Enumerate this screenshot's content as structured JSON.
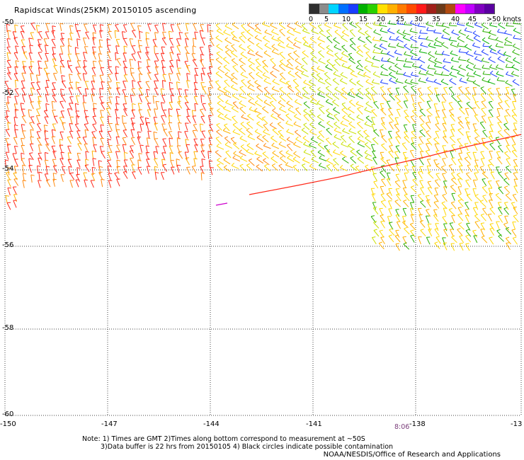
{
  "title": "Rapidscat Winds(25KM)  20150105  ascending",
  "legend": {
    "labels": [
      "0",
      "5",
      "10",
      "15",
      "20",
      "25",
      "30",
      "35",
      "40",
      "45",
      ">50 knots"
    ],
    "colors": [
      "#2f2f2f",
      "#8c8c8c",
      "#00d4ff",
      "#0070ff",
      "#1a3dff",
      "#00b000",
      "#2ad000",
      "#ffe000",
      "#ffb000",
      "#ff7a00",
      "#ff4a00",
      "#ff1a1a",
      "#a0201a",
      "#6a3a1a",
      "#b04a10",
      "#ff00ff",
      "#c000ff",
      "#8000c0",
      "#5a00a0"
    ]
  },
  "map": {
    "lat_labels": [
      "-50",
      "-52",
      "-54",
      "-56",
      "-58",
      "-60"
    ],
    "lon_labels": [
      "-150",
      "-147",
      "-144",
      "-141",
      "-138",
      "-13"
    ],
    "time_label": "8:06"
  },
  "notes": {
    "line1": "Note: 1) Times are GMT 2)Times along bottom correspond to measurement at ~50S",
    "line2": "3)Data buffer is 22 hrs from 20150105 4) Black circles indicate possible contamination",
    "credit": "NOAA/NESDIS/Office of Research and Applications"
  }
}
